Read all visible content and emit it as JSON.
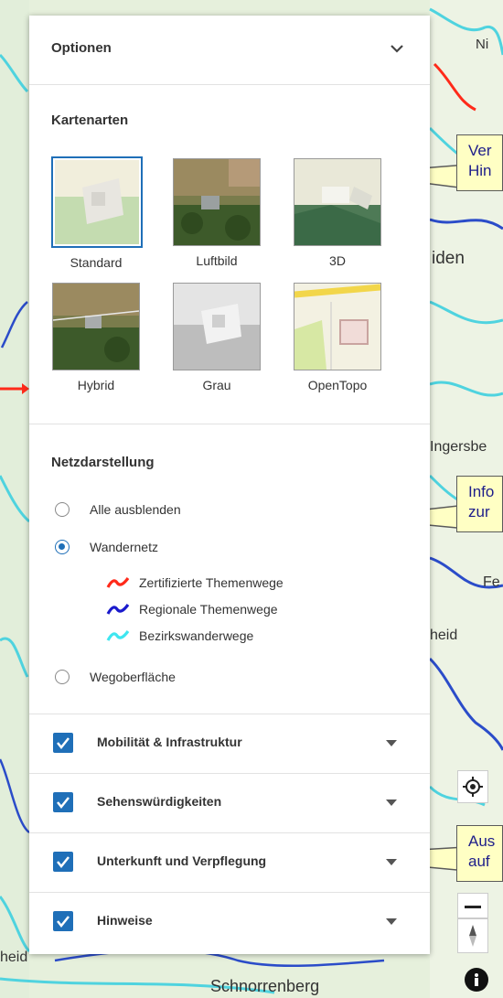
{
  "map": {
    "labels": [
      "Ni",
      "iden",
      "Ingersbe",
      "Fe",
      "heid",
      "heid",
      "Schnorrenberg"
    ]
  },
  "options": {
    "title": "Optionen",
    "kartenarten": {
      "title": "Kartenarten",
      "tiles": [
        {
          "label": "Standard",
          "selected": true
        },
        {
          "label": "Luftbild",
          "selected": false
        },
        {
          "label": "3D",
          "selected": false
        },
        {
          "label": "Hybrid",
          "selected": false
        },
        {
          "label": "Grau",
          "selected": false
        },
        {
          "label": "OpenTopo",
          "selected": false
        }
      ]
    },
    "netz": {
      "title": "Netzdarstellung",
      "radios": [
        {
          "label": "Alle ausblenden",
          "checked": false
        },
        {
          "label": "Wandernetz",
          "checked": true
        },
        {
          "label": "Wegoberfläche",
          "checked": false
        }
      ],
      "legend": [
        {
          "label": "Zertifizierte Themenwege",
          "color": "#ff2a1a"
        },
        {
          "label": "Regionale Themenwege",
          "color": "#1a1acc"
        },
        {
          "label": "Bezirkswanderwege",
          "color": "#3fe6f0"
        }
      ]
    },
    "categories": [
      {
        "label": "Mobilität & Infrastruktur",
        "checked": true
      },
      {
        "label": "Sehenswürdigkeiten",
        "checked": true
      },
      {
        "label": "Unterkunft und Verpflegung",
        "checked": true
      },
      {
        "label": "Hinweise",
        "checked": true
      }
    ]
  },
  "callouts": [
    {
      "line1": "Ver",
      "line2": "Hin"
    },
    {
      "line1": "Info",
      "line2": "zur"
    },
    {
      "line1": "Aus",
      "line2": "auf"
    }
  ],
  "colors": {
    "accent": "#1f6fb8",
    "callout_bg": "#ffffc4",
    "callout_text": "#1d1d8a"
  }
}
